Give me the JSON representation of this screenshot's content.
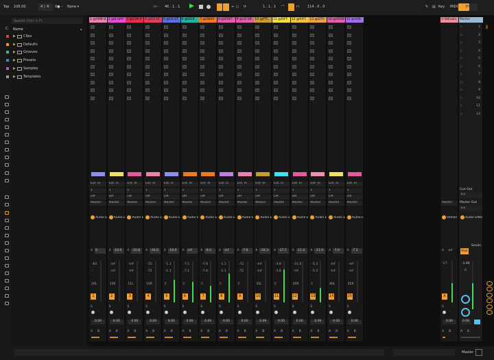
{
  "topbar": {
    "tap": "Tap",
    "tempo": "106.00",
    "meter_num": "4",
    "meter_den": "4",
    "metro": "0● –",
    "quant": "None ▾",
    "position": "46 .  1 .  1",
    "loop_start": "1 .  1 .  1",
    "loop_len": "114 .  0 .  0",
    "key": "Key",
    "midi": "MIDI",
    "cpu": "3%"
  },
  "browser": {
    "search_placeholder": "Search (Ctrl + F)",
    "col_header": "Name",
    "items": [
      {
        "label": "Clips",
        "color": "#e04040"
      },
      {
        "label": "Defaults",
        "color": "#e0a020"
      },
      {
        "label": "Grooves",
        "color": "#40c070"
      },
      {
        "label": "Presets",
        "color": "#4080e0"
      },
      {
        "label": "Samples",
        "color": "#a060d0"
      },
      {
        "label": "Templates",
        "color": "#999999"
      }
    ]
  },
  "tracks": [
    {
      "name": "1 @AMB B",
      "color": "#ee7fae",
      "vol": "0",
      "peak": "-83",
      "db": "-",
      "pan": "20L",
      "num": "1",
      "input": "Ext. In",
      "meter": 0.0,
      "clip": "#8f8fee"
    },
    {
      "name": "2 @8 HAR",
      "color": "#e54fd6",
      "vol": "-10.0",
      "peak": "-inf",
      "db": "-inf",
      "pan": "15R",
      "num": "2",
      "input": "Ext. In",
      "meter": 0.0,
      "clip": "#f0e060"
    },
    {
      "name": "3 @C2A V",
      "color": "#e03050",
      "vol": "-10.8",
      "peak": "-inf",
      "db": "-inf",
      "pan": "11L",
      "num": "3",
      "input": "Ext. In",
      "meter": 0.0,
      "clip": "#e55a9a"
    },
    {
      "name": "4 @CA ST",
      "color": "#e04060",
      "vol": "-16.0",
      "peak": "-72",
      "db": "-72",
      "pan": "10R",
      "num": "4",
      "input": "Ext. In",
      "meter": 0.0,
      "clip": "#ee7fae"
    },
    {
      "name": "5 @CK ST",
      "color": "#5a6ee0",
      "vol": "-19.0",
      "peak": "-1.1",
      "db": "-1.1",
      "pan": "C",
      "num": "5",
      "input": "Ext. In",
      "meter": 0.55,
      "clip": "#8f8fee"
    },
    {
      "name": "6 @KICK",
      "color": "#1fb3a0",
      "vol": "-inf",
      "peak": "-7.1",
      "db": "-7.1",
      "pan": "C",
      "num": "6",
      "input": "Ext. In",
      "meter": 0.5,
      "clip": "#f07a20"
    },
    {
      "name": "7 @SNAR",
      "color": "#f07a20",
      "vol": "-9.0",
      "peak": "-7.6",
      "db": "-7.6",
      "pan": "C",
      "num": "7",
      "input": "Ext. In",
      "meter": 0.4,
      "clip": "#f07a20"
    },
    {
      "name": "8 @SYNT",
      "color": "#e55aaa",
      "vol": "-inf",
      "peak": "-1.1",
      "db": "-1.1",
      "pan": "C",
      "num": "8",
      "input": "Ext. In",
      "meter": 0.7,
      "clip": "#c080e0"
    },
    {
      "name": "9 @LD SR",
      "color": "#e55aaa",
      "vol": "-7.8",
      "peak": "-72",
      "db": "-72",
      "pan": "C",
      "num": "9",
      "input": "Ext. In",
      "meter": 0.0,
      "clip": "#ee7fae"
    },
    {
      "name": "10 @PTC",
      "color": "#c99a30",
      "vol": "-16.3",
      "peak": "-inf",
      "db": "-inf",
      "pan": "35L",
      "num": "10",
      "input": "Ext. In",
      "meter": 0.0,
      "clip": "#c99a30"
    },
    {
      "name": "11 @RIFF",
      "color": "#f0e040",
      "vol": "-17.7",
      "peak": "-3.8",
      "db": "-3.8",
      "pan": "C",
      "num": "11",
      "input": "Ext. In",
      "meter": 0.8,
      "clip": "#40e0f0"
    },
    {
      "name": "12 @RIFF",
      "color": "#f0c040",
      "vol": "-11.0",
      "peak": "-11.0",
      "db": "-inf",
      "pan": "20R",
      "num": "12",
      "input": "Ext. In",
      "meter": 0.0,
      "clip": "#e55a9a"
    },
    {
      "name": "13 @SITA",
      "color": "#f0a040",
      "vol": "-11.0",
      "peak": "-5.3",
      "db": "-5.3",
      "pan": "C",
      "num": "13",
      "input": "Ext. In",
      "meter": 0.35,
      "clip": "#ee8fae"
    },
    {
      "name": "14 @VERB",
      "color": "#e060b0",
      "vol": "-7.0",
      "peak": "-inf",
      "db": "-inf",
      "pan": "80L",
      "num": "14",
      "input": "Ext. In",
      "meter": 0.0,
      "clip": "#f0e060"
    },
    {
      "name": "15 @VOX",
      "color": "#a070f0",
      "vol": "-7.2",
      "peak": "-inf",
      "db": "-inf",
      "pan": "45R",
      "num": "15",
      "input": "Ext. In",
      "meter": 0.0,
      "clip": "#e55a9a"
    }
  ],
  "labels": {
    "chan": "1",
    "off": "Off",
    "master_out": "Master",
    "send": "Audio E",
    "vol_prefix": "A",
    "pan_center": "0.00",
    "solo": "S",
    "a": "A",
    "b": "B"
  },
  "return": {
    "name": "A Valhalla",
    "send_label": "Valhall",
    "vol": "-inf",
    "peak": "-17",
    "pan": "0.00",
    "num": "A",
    "output": "Master"
  },
  "master": {
    "name": "Master",
    "cue_out": "Cue Out",
    "cue_val": "1/2",
    "master_out": "Master Out",
    "master_val": "1/2",
    "send_label": "Audio Effec",
    "post": "Post",
    "sends": "Sends",
    "peak": "-1.00",
    "db": "0",
    "pan": "0.00",
    "scene_nums": [
      "1",
      "2",
      "3",
      "4",
      "5",
      "6",
      "7",
      "8",
      "9",
      "10",
      "11",
      "12"
    ]
  },
  "status": {
    "right": "Master"
  }
}
